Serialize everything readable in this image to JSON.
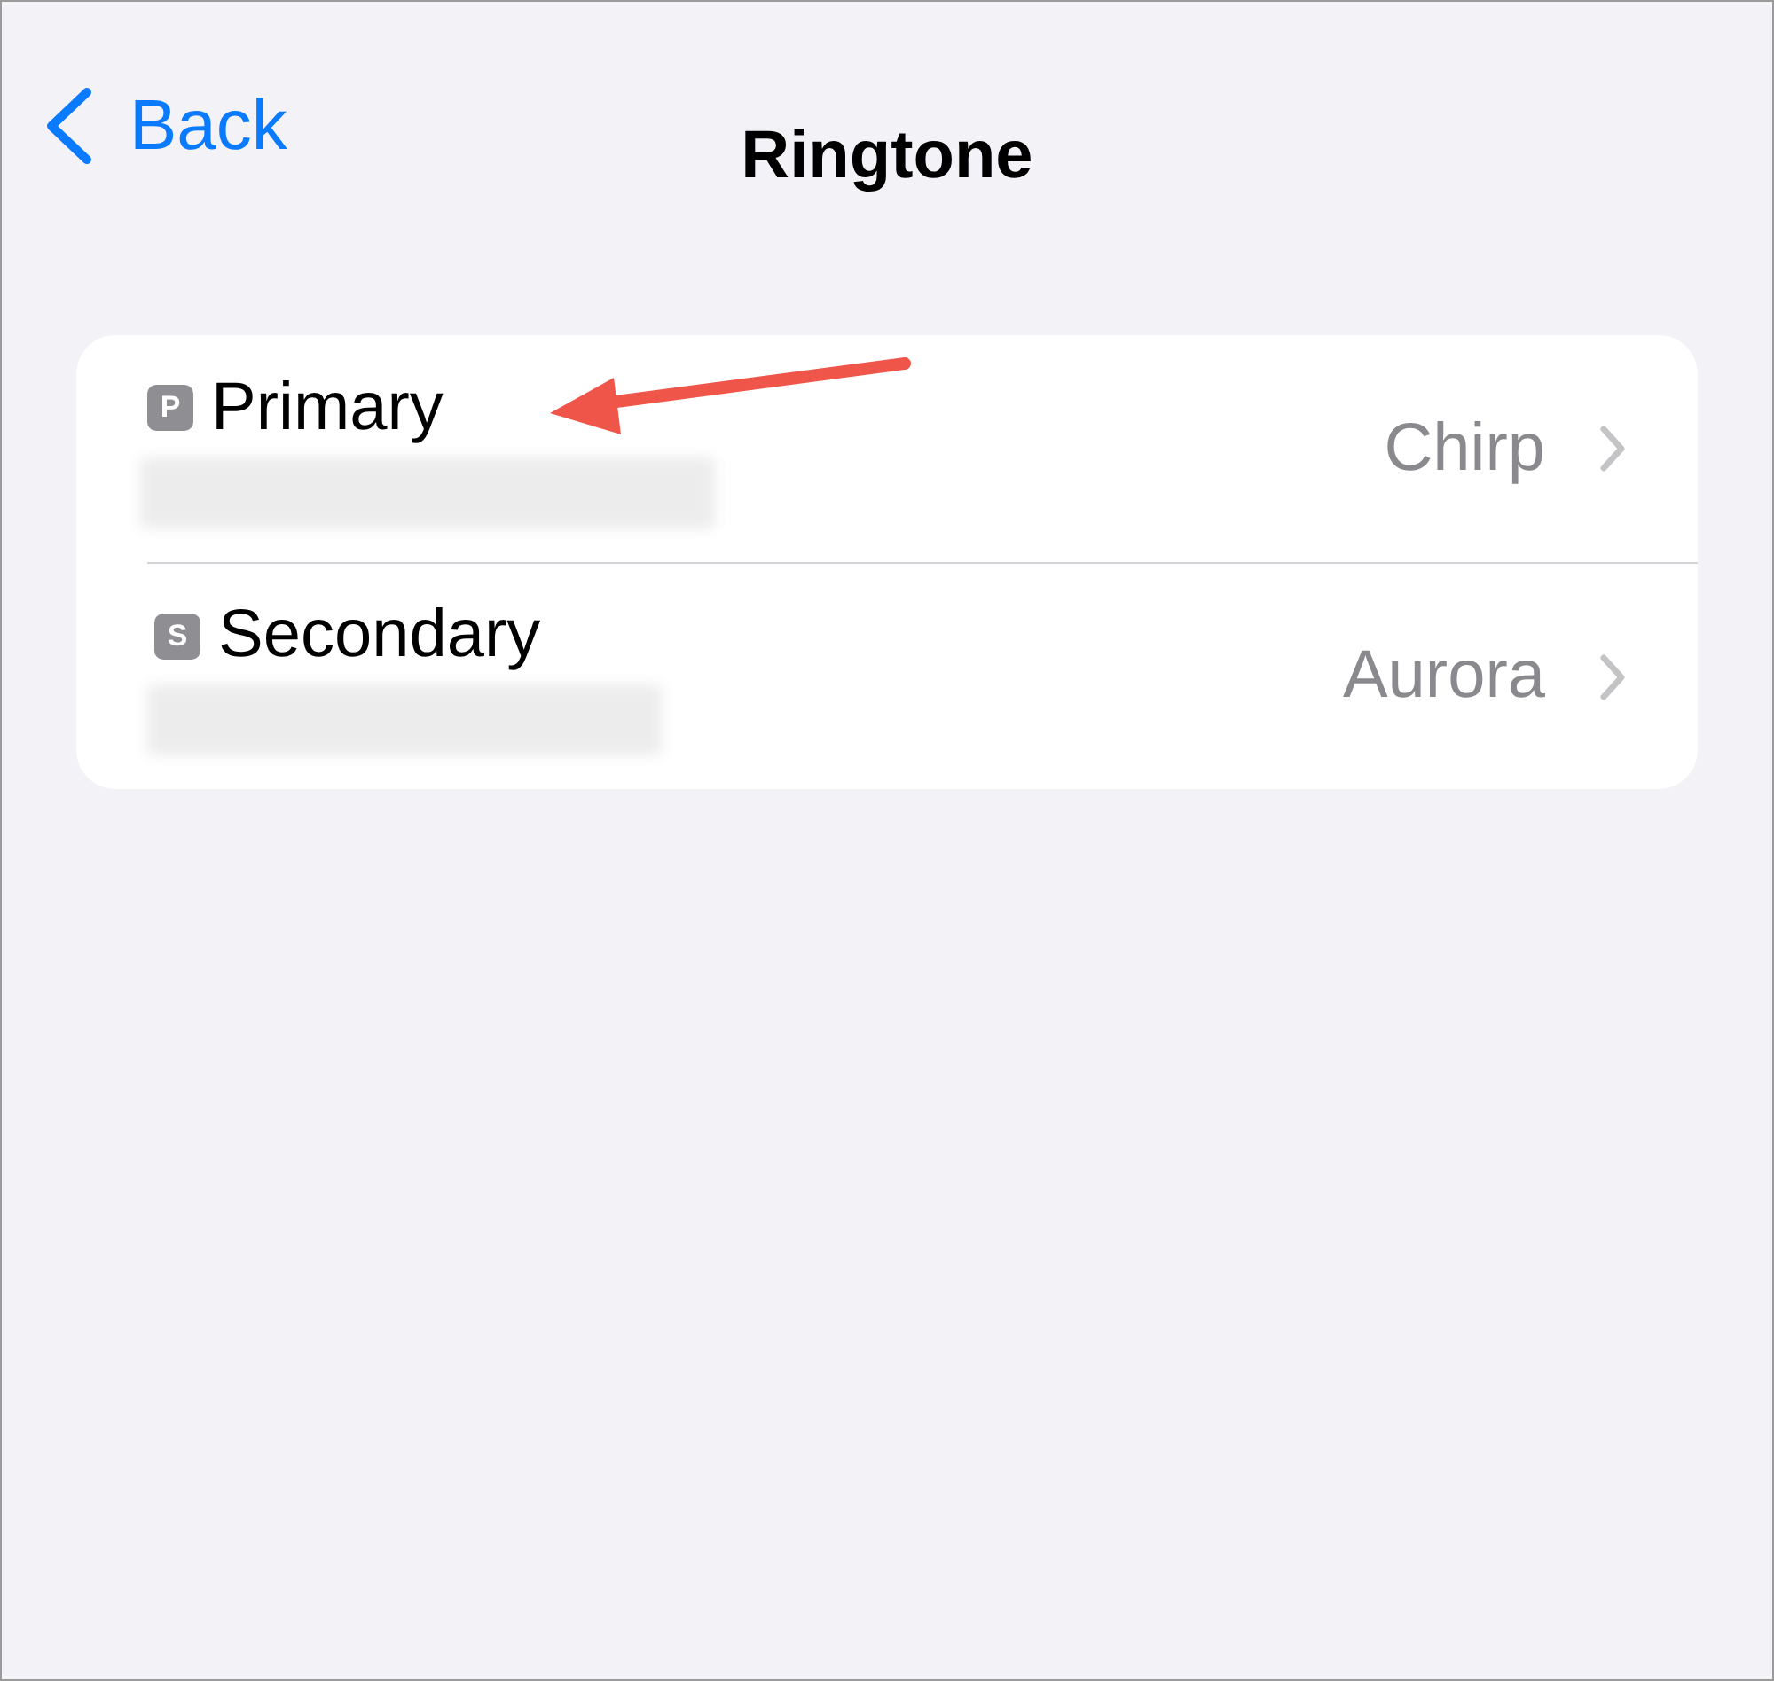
{
  "nav": {
    "back": "Back",
    "title": "Ringtone"
  },
  "lines": [
    {
      "badge": "P",
      "name": "Primary",
      "value": "Chirp",
      "annotated": true
    },
    {
      "badge": "S",
      "name": "Secondary",
      "value": "Aurora",
      "annotated": false
    }
  ]
}
